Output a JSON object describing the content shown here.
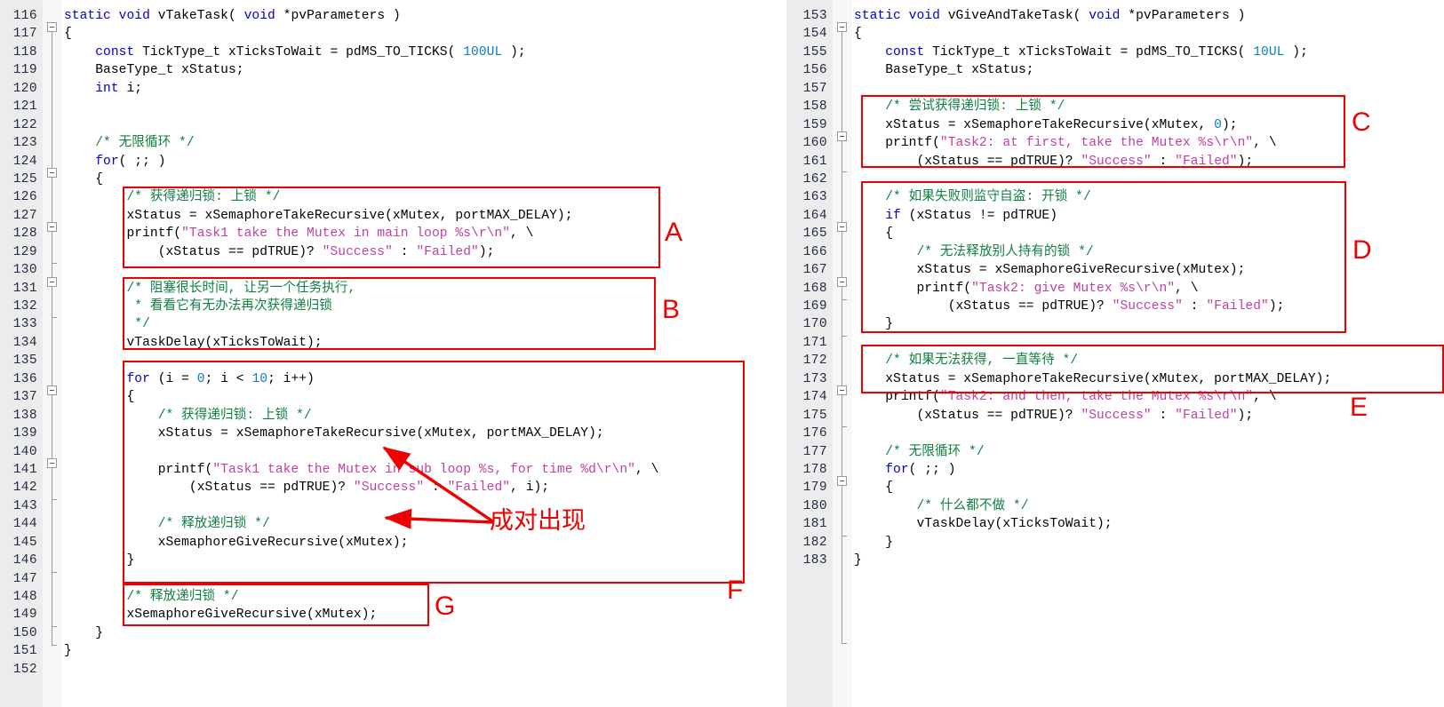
{
  "editor": {
    "language": "C",
    "colors": {
      "gutter_bg": "#ECECEC",
      "fold_bg": "#F7F7F7",
      "keyword": "#0000CC",
      "number": "#0B7FBF",
      "string": "#C040A0",
      "comment": "#108040",
      "code": "#000000",
      "annotation": "#EE0000"
    }
  },
  "left_panel": {
    "first_line": 116,
    "lines": [
      {
        "n": 116,
        "tokens": [
          {
            "t": "static void ",
            "c": "kw"
          },
          {
            "t": "vTakeTask( ",
            "c": "plain"
          },
          {
            "t": "void ",
            "c": "kw"
          },
          {
            "t": "*pvParameters )",
            "c": "plain"
          }
        ]
      },
      {
        "n": 117,
        "tokens": [
          {
            "t": "{",
            "c": "plain"
          }
        ]
      },
      {
        "n": 118,
        "tokens": [
          {
            "t": "    ",
            "c": "plain"
          },
          {
            "t": "const ",
            "c": "kw"
          },
          {
            "t": "TickType_t xTicksToWait = pdMS_TO_TICKS( ",
            "c": "plain"
          },
          {
            "t": "100UL",
            "c": "num"
          },
          {
            "t": " );",
            "c": "plain"
          }
        ]
      },
      {
        "n": 119,
        "tokens": [
          {
            "t": "    BaseType_t xStatus;",
            "c": "plain"
          }
        ]
      },
      {
        "n": 120,
        "tokens": [
          {
            "t": "    ",
            "c": "plain"
          },
          {
            "t": "int",
            "c": "kw"
          },
          {
            "t": " i;",
            "c": "plain"
          }
        ]
      },
      {
        "n": 121,
        "tokens": []
      },
      {
        "n": 122,
        "tokens": []
      },
      {
        "n": 123,
        "tokens": [
          {
            "t": "    /* 无限循环 */",
            "c": "cmt"
          }
        ]
      },
      {
        "n": 124,
        "tokens": [
          {
            "t": "    ",
            "c": "plain"
          },
          {
            "t": "for",
            "c": "kw"
          },
          {
            "t": "( ;; )",
            "c": "plain"
          }
        ]
      },
      {
        "n": 125,
        "tokens": [
          {
            "t": "    {",
            "c": "plain"
          }
        ]
      },
      {
        "n": 126,
        "tokens": [
          {
            "t": "        /* 获得递归锁: 上锁 */",
            "c": "cmt"
          }
        ]
      },
      {
        "n": 127,
        "tokens": [
          {
            "t": "        xStatus = xSemaphoreTakeRecursive(xMutex, portMAX_DELAY);",
            "c": "plain"
          }
        ]
      },
      {
        "n": 128,
        "tokens": [
          {
            "t": "        printf(",
            "c": "plain"
          },
          {
            "t": "\"Task1 take the Mutex in main loop %s\\r\\n\"",
            "c": "str"
          },
          {
            "t": ", \\",
            "c": "plain"
          }
        ]
      },
      {
        "n": 129,
        "tokens": [
          {
            "t": "            (xStatus == pdTRUE)? ",
            "c": "plain"
          },
          {
            "t": "\"Success\"",
            "c": "str"
          },
          {
            "t": " : ",
            "c": "plain"
          },
          {
            "t": "\"Failed\"",
            "c": "str"
          },
          {
            "t": ");",
            "c": "plain"
          }
        ]
      },
      {
        "n": 130,
        "tokens": []
      },
      {
        "n": 131,
        "tokens": [
          {
            "t": "        /* 阻塞很长时间, 让另一个任务执行,",
            "c": "cmt"
          }
        ]
      },
      {
        "n": 132,
        "tokens": [
          {
            "t": "         * 看看它有无办法再次获得递归锁",
            "c": "cmt"
          }
        ]
      },
      {
        "n": 133,
        "tokens": [
          {
            "t": "         */",
            "c": "cmt"
          }
        ]
      },
      {
        "n": 134,
        "tokens": [
          {
            "t": "        vTaskDelay(xTicksToWait);",
            "c": "plain"
          }
        ]
      },
      {
        "n": 135,
        "tokens": []
      },
      {
        "n": 136,
        "tokens": [
          {
            "t": "        ",
            "c": "plain"
          },
          {
            "t": "for",
            "c": "kw"
          },
          {
            "t": " (i = ",
            "c": "plain"
          },
          {
            "t": "0",
            "c": "num"
          },
          {
            "t": "; i < ",
            "c": "plain"
          },
          {
            "t": "10",
            "c": "num"
          },
          {
            "t": "; i++)",
            "c": "plain"
          }
        ]
      },
      {
        "n": 137,
        "tokens": [
          {
            "t": "        {",
            "c": "plain"
          }
        ]
      },
      {
        "n": 138,
        "tokens": [
          {
            "t": "            /* 获得递归锁: 上锁 */",
            "c": "cmt"
          }
        ]
      },
      {
        "n": 139,
        "tokens": [
          {
            "t": "            xStatus = xSemaphoreTakeRecursive(xMutex, portMAX_DELAY);",
            "c": "plain"
          }
        ]
      },
      {
        "n": 140,
        "tokens": []
      },
      {
        "n": 141,
        "tokens": [
          {
            "t": "            printf(",
            "c": "plain"
          },
          {
            "t": "\"Task1 take the Mutex in sub loop %s, for time %d\\r\\n\"",
            "c": "str"
          },
          {
            "t": ", \\",
            "c": "plain"
          }
        ]
      },
      {
        "n": 142,
        "tokens": [
          {
            "t": "                (xStatus == pdTRUE)? ",
            "c": "plain"
          },
          {
            "t": "\"Success\"",
            "c": "str"
          },
          {
            "t": " : ",
            "c": "plain"
          },
          {
            "t": "\"Failed\"",
            "c": "str"
          },
          {
            "t": ", i);",
            "c": "plain"
          }
        ]
      },
      {
        "n": 143,
        "tokens": []
      },
      {
        "n": 144,
        "tokens": [
          {
            "t": "            /* 释放递归锁 */",
            "c": "cmt"
          }
        ]
      },
      {
        "n": 145,
        "tokens": [
          {
            "t": "            xSemaphoreGiveRecursive(xMutex);",
            "c": "plain"
          }
        ]
      },
      {
        "n": 146,
        "tokens": [
          {
            "t": "        }",
            "c": "plain"
          }
        ]
      },
      {
        "n": 147,
        "tokens": []
      },
      {
        "n": 148,
        "tokens": [
          {
            "t": "        /* 释放递归锁 */",
            "c": "cmt"
          }
        ]
      },
      {
        "n": 149,
        "tokens": [
          {
            "t": "        xSemaphoreGiveRecursive(xMutex);",
            "c": "plain"
          }
        ]
      },
      {
        "n": 150,
        "tokens": [
          {
            "t": "    }",
            "c": "plain"
          }
        ]
      },
      {
        "n": 151,
        "tokens": [
          {
            "t": "}",
            "c": "plain"
          }
        ]
      },
      {
        "n": 152,
        "tokens": []
      }
    ]
  },
  "right_panel": {
    "first_line": 153,
    "lines": [
      {
        "n": 153,
        "tokens": [
          {
            "t": "static void ",
            "c": "kw"
          },
          {
            "t": "vGiveAndTakeTask( ",
            "c": "plain"
          },
          {
            "t": "void ",
            "c": "kw"
          },
          {
            "t": "*pvParameters )",
            "c": "plain"
          }
        ]
      },
      {
        "n": 154,
        "tokens": [
          {
            "t": "{",
            "c": "plain"
          }
        ]
      },
      {
        "n": 155,
        "tokens": [
          {
            "t": "    ",
            "c": "plain"
          },
          {
            "t": "const ",
            "c": "kw"
          },
          {
            "t": "TickType_t xTicksToWait = pdMS_TO_TICKS( ",
            "c": "plain"
          },
          {
            "t": "10UL",
            "c": "num"
          },
          {
            "t": " );",
            "c": "plain"
          }
        ]
      },
      {
        "n": 156,
        "tokens": [
          {
            "t": "    BaseType_t xStatus;",
            "c": "plain"
          }
        ]
      },
      {
        "n": 157,
        "tokens": []
      },
      {
        "n": 158,
        "tokens": [
          {
            "t": "    /* 尝试获得递归锁: 上锁 */",
            "c": "cmt"
          }
        ]
      },
      {
        "n": 159,
        "tokens": [
          {
            "t": "    xStatus = xSemaphoreTakeRecursive(xMutex, ",
            "c": "plain"
          },
          {
            "t": "0",
            "c": "num"
          },
          {
            "t": ");",
            "c": "plain"
          }
        ]
      },
      {
        "n": 160,
        "tokens": [
          {
            "t": "    printf(",
            "c": "plain"
          },
          {
            "t": "\"Task2: at first, take the Mutex %s\\r\\n\"",
            "c": "str"
          },
          {
            "t": ", \\",
            "c": "plain"
          }
        ]
      },
      {
        "n": 161,
        "tokens": [
          {
            "t": "        (xStatus == pdTRUE)? ",
            "c": "plain"
          },
          {
            "t": "\"Success\"",
            "c": "str"
          },
          {
            "t": " : ",
            "c": "plain"
          },
          {
            "t": "\"Failed\"",
            "c": "str"
          },
          {
            "t": ");",
            "c": "plain"
          }
        ]
      },
      {
        "n": 162,
        "tokens": []
      },
      {
        "n": 163,
        "tokens": [
          {
            "t": "    /* 如果失败则监守自盗: 开锁 */",
            "c": "cmt"
          }
        ]
      },
      {
        "n": 164,
        "tokens": [
          {
            "t": "    ",
            "c": "plain"
          },
          {
            "t": "if",
            "c": "kw"
          },
          {
            "t": " (xStatus != pdTRUE)",
            "c": "plain"
          }
        ]
      },
      {
        "n": 165,
        "tokens": [
          {
            "t": "    {",
            "c": "plain"
          }
        ]
      },
      {
        "n": 166,
        "tokens": [
          {
            "t": "        /* 无法释放别人持有的锁 */",
            "c": "cmt"
          }
        ]
      },
      {
        "n": 167,
        "tokens": [
          {
            "t": "        xStatus = xSemaphoreGiveRecursive(xMutex);",
            "c": "plain"
          }
        ]
      },
      {
        "n": 168,
        "tokens": [
          {
            "t": "        printf(",
            "c": "plain"
          },
          {
            "t": "\"Task2: give Mutex %s\\r\\n\"",
            "c": "str"
          },
          {
            "t": ", \\",
            "c": "plain"
          }
        ]
      },
      {
        "n": 169,
        "tokens": [
          {
            "t": "            (xStatus == pdTRUE)? ",
            "c": "plain"
          },
          {
            "t": "\"Success\"",
            "c": "str"
          },
          {
            "t": " : ",
            "c": "plain"
          },
          {
            "t": "\"Failed\"",
            "c": "str"
          },
          {
            "t": ");",
            "c": "plain"
          }
        ]
      },
      {
        "n": 170,
        "tokens": [
          {
            "t": "    }",
            "c": "plain"
          }
        ]
      },
      {
        "n": 171,
        "tokens": []
      },
      {
        "n": 172,
        "tokens": [
          {
            "t": "    /* 如果无法获得, 一直等待 */",
            "c": "cmt"
          }
        ]
      },
      {
        "n": 173,
        "tokens": [
          {
            "t": "    xStatus = xSemaphoreTakeRecursive(xMutex, portMAX_DELAY);",
            "c": "plain"
          }
        ]
      },
      {
        "n": 174,
        "tokens": [
          {
            "t": "    printf(",
            "c": "plain"
          },
          {
            "t": "\"Task2: and then, take the Mutex %s\\r\\n\"",
            "c": "str"
          },
          {
            "t": ", \\",
            "c": "plain"
          }
        ]
      },
      {
        "n": 175,
        "tokens": [
          {
            "t": "        (xStatus == pdTRUE)? ",
            "c": "plain"
          },
          {
            "t": "\"Success\"",
            "c": "str"
          },
          {
            "t": " : ",
            "c": "plain"
          },
          {
            "t": "\"Failed\"",
            "c": "str"
          },
          {
            "t": ");",
            "c": "plain"
          }
        ]
      },
      {
        "n": 176,
        "tokens": []
      },
      {
        "n": 177,
        "tokens": [
          {
            "t": "    /* 无限循环 */",
            "c": "cmt"
          }
        ]
      },
      {
        "n": 178,
        "tokens": [
          {
            "t": "    ",
            "c": "plain"
          },
          {
            "t": "for",
            "c": "kw"
          },
          {
            "t": "( ;; )",
            "c": "plain"
          }
        ]
      },
      {
        "n": 179,
        "tokens": [
          {
            "t": "    {",
            "c": "plain"
          }
        ]
      },
      {
        "n": 180,
        "tokens": [
          {
            "t": "        /* 什么都不做 */",
            "c": "cmt"
          }
        ]
      },
      {
        "n": 181,
        "tokens": [
          {
            "t": "        vTaskDelay(xTicksToWait);",
            "c": "plain"
          }
        ]
      },
      {
        "n": 182,
        "tokens": [
          {
            "t": "    }",
            "c": "plain"
          }
        ]
      },
      {
        "n": 183,
        "tokens": [
          {
            "t": "}",
            "c": "plain"
          }
        ]
      }
    ]
  },
  "annotations": {
    "labels": [
      {
        "id": "A",
        "text": "A"
      },
      {
        "id": "B",
        "text": "B"
      },
      {
        "id": "C",
        "text": "C"
      },
      {
        "id": "D",
        "text": "D"
      },
      {
        "id": "E",
        "text": "E"
      },
      {
        "id": "F",
        "text": "F"
      },
      {
        "id": "G",
        "text": "G"
      }
    ],
    "callout": {
      "text": "成对出现"
    }
  }
}
